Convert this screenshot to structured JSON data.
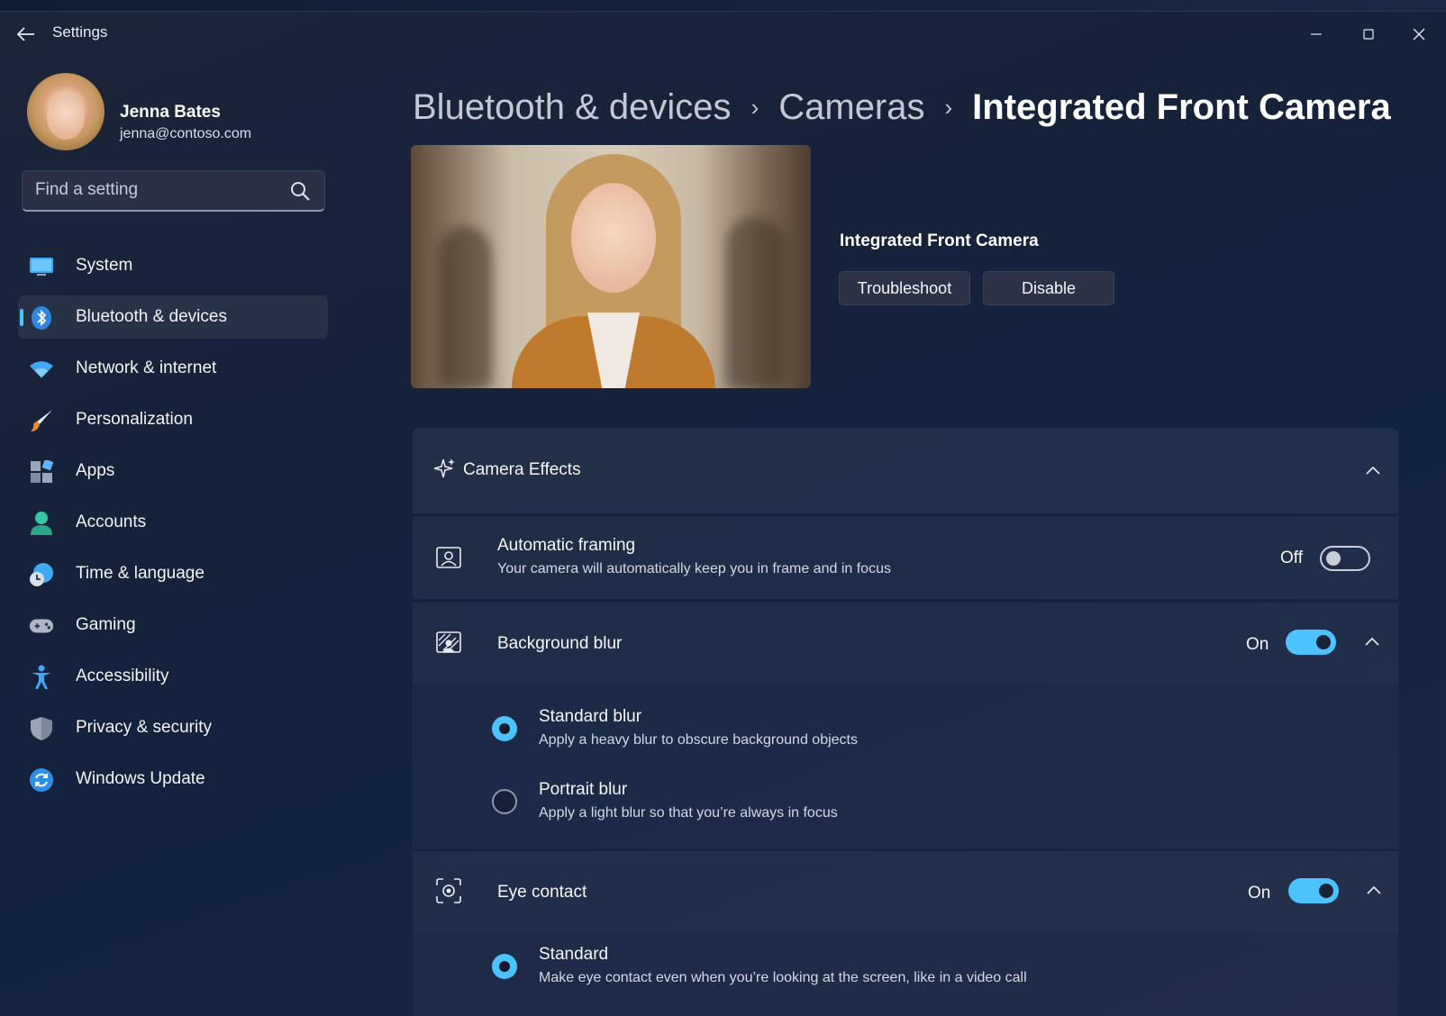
{
  "window": {
    "title": "Settings"
  },
  "user": {
    "name": "Jenna Bates",
    "email": "jenna@contoso.com"
  },
  "search": {
    "placeholder": "Find a setting"
  },
  "sidebar": {
    "items": [
      {
        "label": "System",
        "icon": "monitor-icon"
      },
      {
        "label": "Bluetooth & devices",
        "icon": "bluetooth-icon",
        "selected": true
      },
      {
        "label": "Network & internet",
        "icon": "wifi-icon"
      },
      {
        "label": "Personalization",
        "icon": "brush-icon"
      },
      {
        "label": "Apps",
        "icon": "apps-icon"
      },
      {
        "label": "Accounts",
        "icon": "person-icon"
      },
      {
        "label": "Time & language",
        "icon": "globe-clock-icon"
      },
      {
        "label": "Gaming",
        "icon": "gamepad-icon"
      },
      {
        "label": "Accessibility",
        "icon": "accessibility-icon"
      },
      {
        "label": "Privacy & security",
        "icon": "shield-icon"
      },
      {
        "label": "Windows Update",
        "icon": "update-icon"
      }
    ]
  },
  "breadcrumb": {
    "items": [
      "Bluetooth & devices",
      "Cameras",
      "Integrated Front Camera"
    ]
  },
  "device": {
    "name": "Integrated Front Camera",
    "troubleshoot_label": "Troubleshoot",
    "disable_label": "Disable"
  },
  "camera_effects": {
    "title": "Camera Effects",
    "automatic_framing": {
      "title": "Automatic framing",
      "description": "Your camera will automatically keep you in frame and in focus",
      "state": "Off"
    },
    "background_blur": {
      "title": "Background blur",
      "state": "On",
      "options": [
        {
          "title": "Standard blur",
          "description": "Apply a heavy blur to obscure background objects",
          "selected": true
        },
        {
          "title": "Portrait blur",
          "description": "Apply a light blur so that you’re always in focus",
          "selected": false
        }
      ]
    },
    "eye_contact": {
      "title": "Eye contact",
      "state": "On",
      "options": [
        {
          "title": "Standard",
          "description": "Make eye contact even when you’re looking at the screen, like in a video call",
          "selected": true
        }
      ]
    }
  },
  "colors": {
    "accent": "#4cc2ff",
    "background": "#16223a"
  }
}
